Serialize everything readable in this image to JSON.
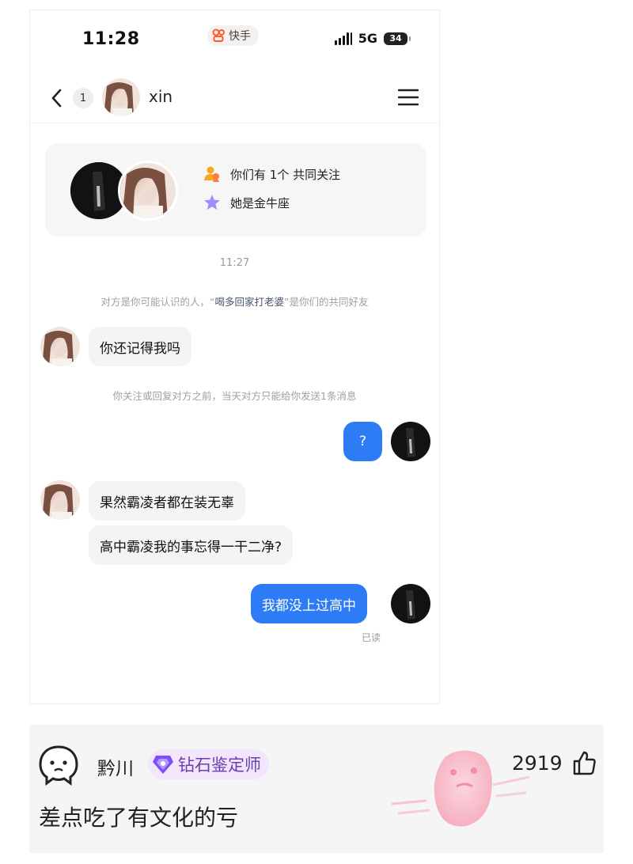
{
  "status_bar": {
    "time": "11:28",
    "app_label": "快手",
    "network": "5G",
    "battery": "34"
  },
  "nav": {
    "unread_count": "1",
    "contact_name": "xin"
  },
  "profile_card": {
    "mutual_follow": "你们有 1个 共同关注",
    "zodiac": "她是金牛座"
  },
  "chat": {
    "timestamp": "11:27",
    "mutual_friend_notice": {
      "prefix": "对方是你可能认识的人，“",
      "friend_name": "喝多回家打老婆",
      "suffix": "”是你们的共同好友"
    },
    "limit_notice": "你关注或回复对方之前，当天对方只能给你发送1条消息",
    "messages": [
      {
        "side": "in",
        "text": "你还记得我吗"
      },
      {
        "side": "out",
        "text": "?"
      },
      {
        "side": "in",
        "text": "果然霸凌者都在装无辜"
      },
      {
        "side": "in",
        "text": "高中霸凌我的事忘得一干二净?"
      },
      {
        "side": "out",
        "text": "我都没上过高中"
      }
    ],
    "read_status": "已读"
  },
  "comment": {
    "username": "黔川",
    "badge": "钻石鉴定师",
    "text": "差点吃了有文化的亏",
    "likes": "2919"
  },
  "colors": {
    "accent_blue": "#2d7cf6",
    "badge_purple": "#6a3fb0"
  }
}
